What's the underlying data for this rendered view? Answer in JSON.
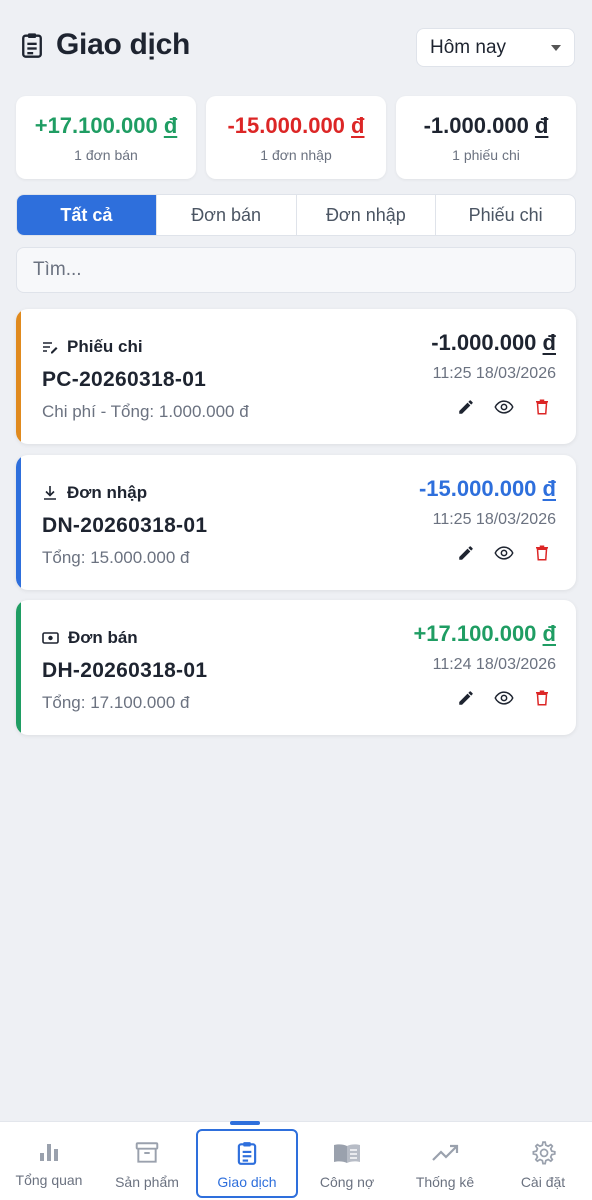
{
  "header": {
    "title": "Giao dịch",
    "period": "Hôm nay"
  },
  "summary": [
    {
      "amount": "+17.100.000",
      "currency": "đ",
      "label": "1 đơn bán",
      "color": "#1f9d63"
    },
    {
      "amount": "-15.000.000",
      "currency": "đ",
      "label": "1 đơn nhập",
      "color": "#dc2626"
    },
    {
      "amount": "-1.000.000",
      "currency": "đ",
      "label": "1 phiếu chi",
      "color": "#1e2430"
    }
  ],
  "tabs": [
    {
      "label": "Tất cả",
      "active": true
    },
    {
      "label": "Đơn bán",
      "active": false
    },
    {
      "label": "Đơn nhập",
      "active": false
    },
    {
      "label": "Phiếu chi",
      "active": false
    }
  ],
  "search": {
    "placeholder": "Tìm..."
  },
  "transactions": [
    {
      "type": "Phiếu chi",
      "icon": "expense-note-icon",
      "code": "PC-20260318-01",
      "desc": "Chi phí - Tổng: 1.000.000 đ",
      "amount": "-1.000.000",
      "currency": "đ",
      "time": "11:25 18/03/2026",
      "accent": "#e08a1e",
      "amount_color": "#1e2430"
    },
    {
      "type": "Đơn nhập",
      "icon": "download-icon",
      "code": "DN-20260318-01",
      "desc": "Tổng: 15.000.000 đ",
      "amount": "-15.000.000",
      "currency": "đ",
      "time": "11:25 18/03/2026",
      "accent": "#2e6fdc",
      "amount_color": "#2e6fdc"
    },
    {
      "type": "Đơn bán",
      "icon": "cash-icon",
      "code": "DH-20260318-01",
      "desc": "Tổng: 17.100.000 đ",
      "amount": "+17.100.000",
      "currency": "đ",
      "time": "11:24 18/03/2026",
      "accent": "#1f9d63",
      "amount_color": "#1f9d63"
    }
  ],
  "nav": [
    {
      "label": "Tổng quan",
      "icon": "bar-chart-icon",
      "active": false
    },
    {
      "label": "Sản phẩm",
      "icon": "archive-box-icon",
      "active": false
    },
    {
      "label": "Giao dịch",
      "icon": "clipboard-icon",
      "active": true
    },
    {
      "label": "Công nợ",
      "icon": "book-icon",
      "active": false
    },
    {
      "label": "Thống kê",
      "icon": "trending-up-icon",
      "active": false
    },
    {
      "label": "Cài đặt",
      "icon": "gear-icon",
      "active": false
    }
  ]
}
